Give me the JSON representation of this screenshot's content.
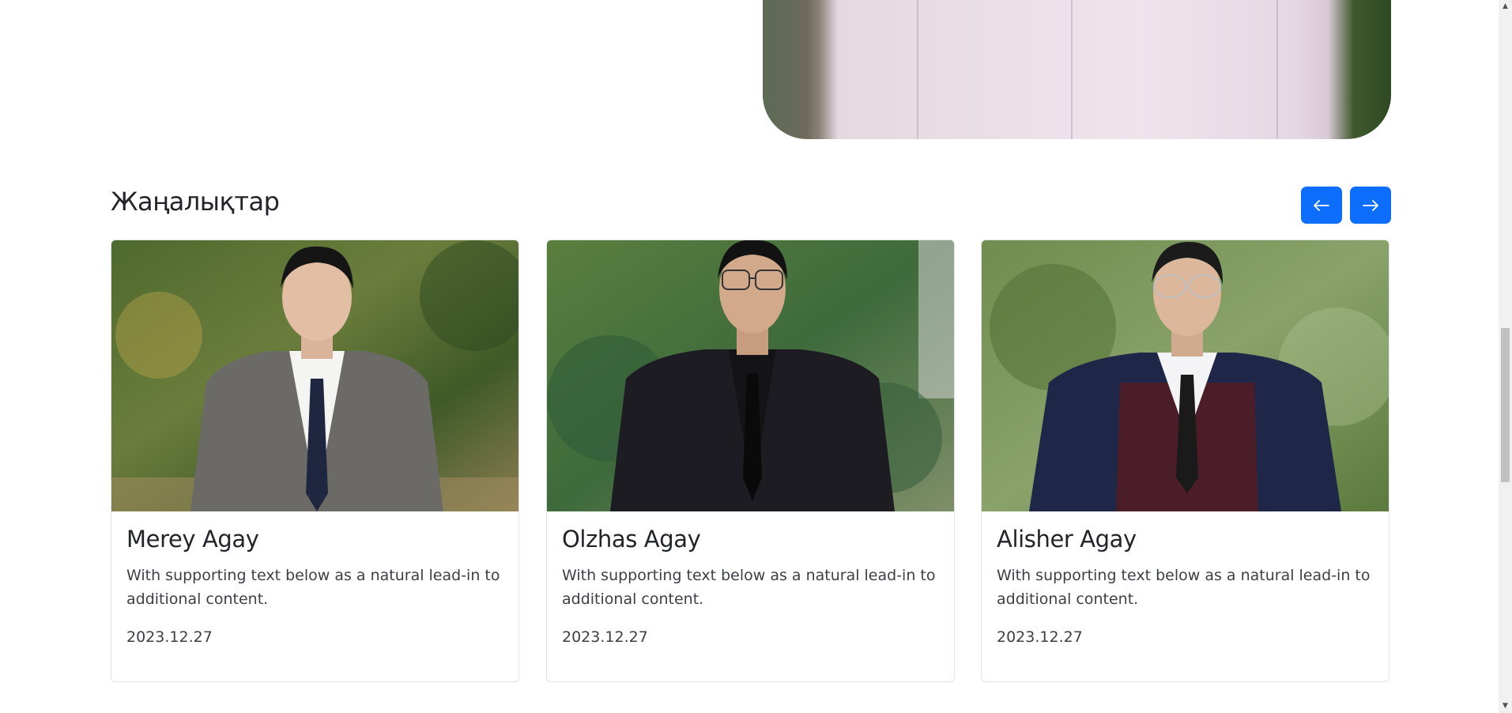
{
  "news": {
    "title": "Жаңалықтар",
    "prev_icon": "arrow-left-icon",
    "next_icon": "arrow-right-icon",
    "cards": [
      {
        "name": "Merey Agay",
        "text": "With supporting text below as a natural lead-in to additional content.",
        "date": "2023.12.27",
        "suit_color": "#6b6a66",
        "tie_color": "#1f2740"
      },
      {
        "name": "Olzhas Agay",
        "text": "With supporting text below as a natural lead-in to additional content.",
        "date": "2023.12.27",
        "suit_color": "#1c1c22",
        "tie_color": "#111111"
      },
      {
        "name": "Alisher Agay",
        "text": "With supporting text below as a natural lead-in to additional content.",
        "date": "2023.12.27",
        "suit_color": "#1f2748",
        "tie_color": "#1a1a1a"
      }
    ]
  },
  "colors": {
    "accent": "#0d6efd",
    "card_border": "#dfe2e6"
  }
}
